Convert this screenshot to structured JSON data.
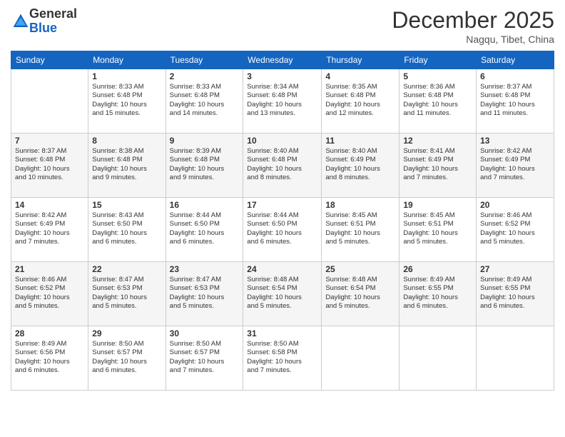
{
  "logo": {
    "general": "General",
    "blue": "Blue"
  },
  "title": "December 2025",
  "location": "Nagqu, Tibet, China",
  "days_of_week": [
    "Sunday",
    "Monday",
    "Tuesday",
    "Wednesday",
    "Thursday",
    "Friday",
    "Saturday"
  ],
  "weeks": [
    [
      {
        "day": "",
        "info": ""
      },
      {
        "day": "1",
        "info": "Sunrise: 8:33 AM\nSunset: 6:48 PM\nDaylight: 10 hours\nand 15 minutes."
      },
      {
        "day": "2",
        "info": "Sunrise: 8:33 AM\nSunset: 6:48 PM\nDaylight: 10 hours\nand 14 minutes."
      },
      {
        "day": "3",
        "info": "Sunrise: 8:34 AM\nSunset: 6:48 PM\nDaylight: 10 hours\nand 13 minutes."
      },
      {
        "day": "4",
        "info": "Sunrise: 8:35 AM\nSunset: 6:48 PM\nDaylight: 10 hours\nand 12 minutes."
      },
      {
        "day": "5",
        "info": "Sunrise: 8:36 AM\nSunset: 6:48 PM\nDaylight: 10 hours\nand 11 minutes."
      },
      {
        "day": "6",
        "info": "Sunrise: 8:37 AM\nSunset: 6:48 PM\nDaylight: 10 hours\nand 11 minutes."
      }
    ],
    [
      {
        "day": "7",
        "info": "Sunrise: 8:37 AM\nSunset: 6:48 PM\nDaylight: 10 hours\nand 10 minutes."
      },
      {
        "day": "8",
        "info": "Sunrise: 8:38 AM\nSunset: 6:48 PM\nDaylight: 10 hours\nand 9 minutes."
      },
      {
        "day": "9",
        "info": "Sunrise: 8:39 AM\nSunset: 6:48 PM\nDaylight: 10 hours\nand 9 minutes."
      },
      {
        "day": "10",
        "info": "Sunrise: 8:40 AM\nSunset: 6:48 PM\nDaylight: 10 hours\nand 8 minutes."
      },
      {
        "day": "11",
        "info": "Sunrise: 8:40 AM\nSunset: 6:49 PM\nDaylight: 10 hours\nand 8 minutes."
      },
      {
        "day": "12",
        "info": "Sunrise: 8:41 AM\nSunset: 6:49 PM\nDaylight: 10 hours\nand 7 minutes."
      },
      {
        "day": "13",
        "info": "Sunrise: 8:42 AM\nSunset: 6:49 PM\nDaylight: 10 hours\nand 7 minutes."
      }
    ],
    [
      {
        "day": "14",
        "info": "Sunrise: 8:42 AM\nSunset: 6:49 PM\nDaylight: 10 hours\nand 7 minutes."
      },
      {
        "day": "15",
        "info": "Sunrise: 8:43 AM\nSunset: 6:50 PM\nDaylight: 10 hours\nand 6 minutes."
      },
      {
        "day": "16",
        "info": "Sunrise: 8:44 AM\nSunset: 6:50 PM\nDaylight: 10 hours\nand 6 minutes."
      },
      {
        "day": "17",
        "info": "Sunrise: 8:44 AM\nSunset: 6:50 PM\nDaylight: 10 hours\nand 6 minutes."
      },
      {
        "day": "18",
        "info": "Sunrise: 8:45 AM\nSunset: 6:51 PM\nDaylight: 10 hours\nand 5 minutes."
      },
      {
        "day": "19",
        "info": "Sunrise: 8:45 AM\nSunset: 6:51 PM\nDaylight: 10 hours\nand 5 minutes."
      },
      {
        "day": "20",
        "info": "Sunrise: 8:46 AM\nSunset: 6:52 PM\nDaylight: 10 hours\nand 5 minutes."
      }
    ],
    [
      {
        "day": "21",
        "info": "Sunrise: 8:46 AM\nSunset: 6:52 PM\nDaylight: 10 hours\nand 5 minutes."
      },
      {
        "day": "22",
        "info": "Sunrise: 8:47 AM\nSunset: 6:53 PM\nDaylight: 10 hours\nand 5 minutes."
      },
      {
        "day": "23",
        "info": "Sunrise: 8:47 AM\nSunset: 6:53 PM\nDaylight: 10 hours\nand 5 minutes."
      },
      {
        "day": "24",
        "info": "Sunrise: 8:48 AM\nSunset: 6:54 PM\nDaylight: 10 hours\nand 5 minutes."
      },
      {
        "day": "25",
        "info": "Sunrise: 8:48 AM\nSunset: 6:54 PM\nDaylight: 10 hours\nand 5 minutes."
      },
      {
        "day": "26",
        "info": "Sunrise: 8:49 AM\nSunset: 6:55 PM\nDaylight: 10 hours\nand 6 minutes."
      },
      {
        "day": "27",
        "info": "Sunrise: 8:49 AM\nSunset: 6:55 PM\nDaylight: 10 hours\nand 6 minutes."
      }
    ],
    [
      {
        "day": "28",
        "info": "Sunrise: 8:49 AM\nSunset: 6:56 PM\nDaylight: 10 hours\nand 6 minutes."
      },
      {
        "day": "29",
        "info": "Sunrise: 8:50 AM\nSunset: 6:57 PM\nDaylight: 10 hours\nand 6 minutes."
      },
      {
        "day": "30",
        "info": "Sunrise: 8:50 AM\nSunset: 6:57 PM\nDaylight: 10 hours\nand 7 minutes."
      },
      {
        "day": "31",
        "info": "Sunrise: 8:50 AM\nSunset: 6:58 PM\nDaylight: 10 hours\nand 7 minutes."
      },
      {
        "day": "",
        "info": ""
      },
      {
        "day": "",
        "info": ""
      },
      {
        "day": "",
        "info": ""
      }
    ]
  ]
}
